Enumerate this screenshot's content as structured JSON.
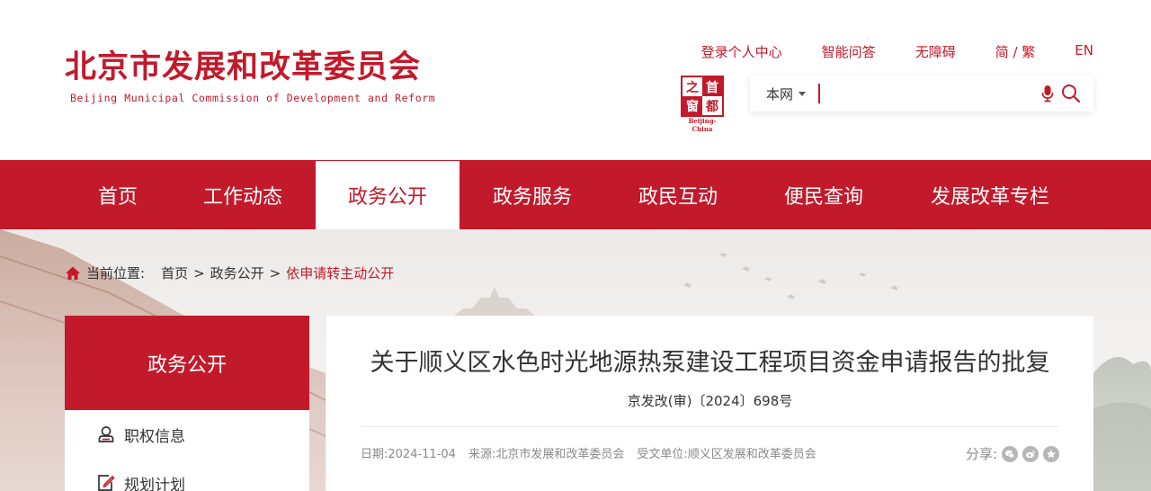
{
  "header": {
    "logo_cn": "北京市发展和改革委员会",
    "logo_en": "Beijing Municipal Commission of Development and Reform",
    "links": [
      "登录个人中心",
      "智能问答",
      "无障碍",
      "简 / 繁",
      "EN"
    ],
    "seal": {
      "chars": [
        "之",
        "首",
        "窗",
        "都"
      ],
      "caption": "Beijing-China"
    },
    "search": {
      "scope": "本网",
      "placeholder": ""
    }
  },
  "nav": {
    "items": [
      "首页",
      "工作动态",
      "政务公开",
      "政务服务",
      "政民互动",
      "便民查询",
      "发展改革专栏"
    ],
    "active": "政务公开"
  },
  "breadcrumb": {
    "label": "当前位置:",
    "items": [
      "首页",
      "政务公开",
      "依申请转主动公开"
    ],
    "separator": ">"
  },
  "sidebar": {
    "title": "政务公开",
    "items": [
      "职权信息",
      "规划计划"
    ]
  },
  "article": {
    "title": "关于顺义区水色时光地源热泵建设工程项目资金申请报告的批复",
    "doc_number": "京发改(审)〔2024〕698号",
    "date_label": "日期:",
    "date": "2024-11-04",
    "source_label": "来源:",
    "source": "北京市发展和改革委员会",
    "recipient_label": "受文单位:",
    "recipient": "顺义区发展和改革委员会",
    "share_label": "分享:"
  },
  "colors": {
    "brand": "#c21a2b",
    "meta": "#8a8a8a"
  }
}
